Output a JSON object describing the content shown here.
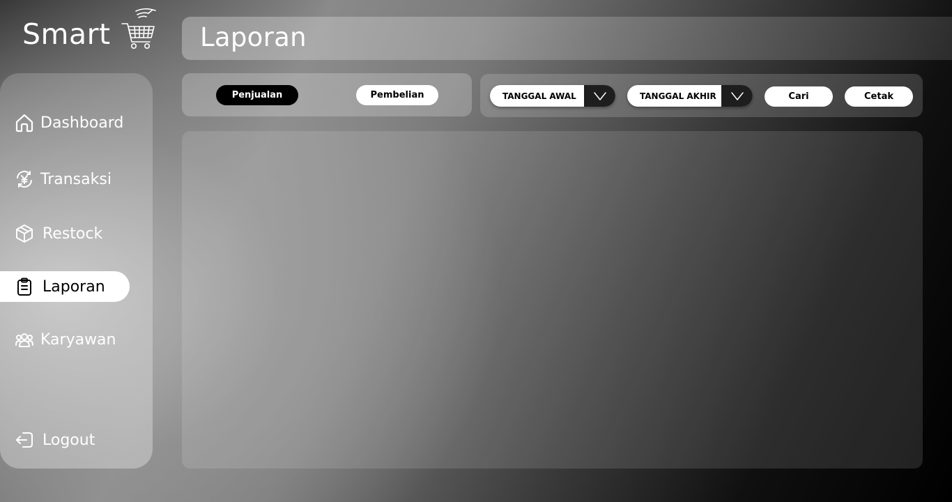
{
  "app": {
    "logo_text": "Smart"
  },
  "header": {
    "title": "Laporan"
  },
  "sidebar": {
    "items": [
      {
        "label": "Dashboard",
        "icon": "home-icon"
      },
      {
        "label": "Transaksi",
        "icon": "yen-exchange-icon"
      },
      {
        "label": "Restock",
        "icon": "box-icon"
      },
      {
        "label": "Laporan",
        "icon": "clipboard-icon",
        "active": true
      },
      {
        "label": "Karyawan",
        "icon": "users-icon"
      }
    ],
    "logout_label": "Logout"
  },
  "report_type": {
    "options": [
      "Penjualan",
      "Pembelian"
    ],
    "selected": "Penjualan"
  },
  "filters": {
    "start_date_label": "TANGGAL AWAL",
    "end_date_label": "TANGGAL AKHIR",
    "search_label": "Cari",
    "print_label": "Cetak"
  },
  "colors": {
    "active_bg": "#ffffff",
    "active_pill": "#000000",
    "dropdown_arrow_bg": "#1e1e1e"
  }
}
